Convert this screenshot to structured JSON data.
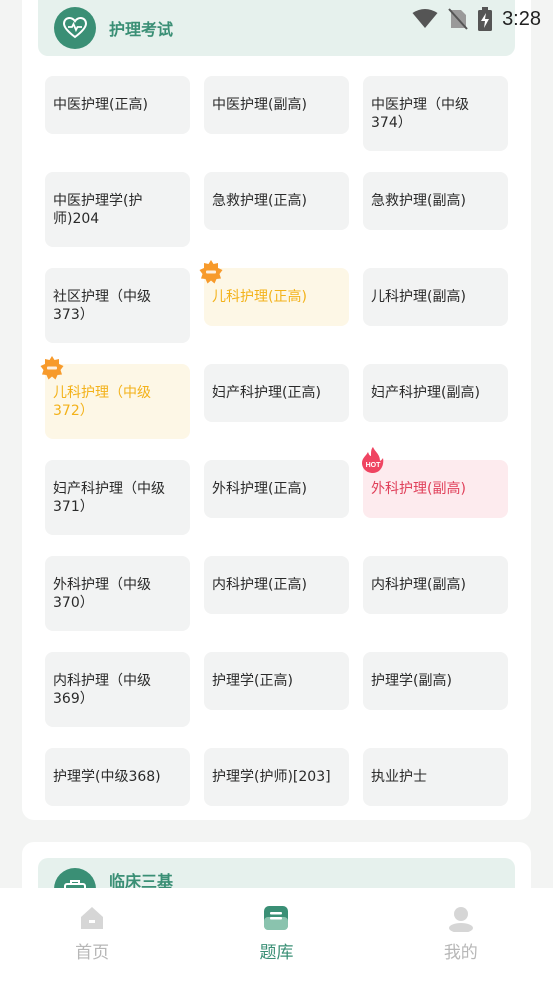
{
  "status": {
    "time": "3:28"
  },
  "section1": {
    "title": "护理考试",
    "icon": "heart-pulse-icon",
    "items": [
      {
        "lines": [
          "中医护理(正高)"
        ],
        "size": "short"
      },
      {
        "lines": [
          "中医护理(副高)"
        ],
        "size": "short"
      },
      {
        "lines": [
          "中医护理（中级",
          "374）"
        ],
        "size": "tall"
      },
      {
        "lines": [
          "中医护理学(护",
          "师)204"
        ],
        "size": "tall"
      },
      {
        "lines": [
          "急救护理(正高)"
        ],
        "size": "short"
      },
      {
        "lines": [
          "急救护理(副高)"
        ],
        "size": "short"
      },
      {
        "lines": [
          "社区护理（中级",
          "373）"
        ],
        "size": "tall"
      },
      {
        "lines": [
          "儿科护理(正高)"
        ],
        "size": "short",
        "highlight": "yellow",
        "badge": "recommend"
      },
      {
        "lines": [
          "儿科护理(副高)"
        ],
        "size": "short"
      },
      {
        "lines": [
          "儿科护理（中级",
          "372）"
        ],
        "size": "tall",
        "highlight": "yellow",
        "badge": "recommend"
      },
      {
        "lines": [
          "妇产科护理(正高)"
        ],
        "size": "short"
      },
      {
        "lines": [
          "妇产科护理(副高)"
        ],
        "size": "short"
      },
      {
        "lines": [
          "妇产科护理（中级",
          "371）"
        ],
        "size": "tall"
      },
      {
        "lines": [
          "外科护理(正高)"
        ],
        "size": "short"
      },
      {
        "lines": [
          "外科护理(副高)"
        ],
        "size": "short",
        "highlight": "red",
        "badge": "hot"
      },
      {
        "lines": [
          "外科护理（中级",
          "370）"
        ],
        "size": "tall"
      },
      {
        "lines": [
          "内科护理(正高)"
        ],
        "size": "short"
      },
      {
        "lines": [
          "内科护理(副高)"
        ],
        "size": "short"
      },
      {
        "lines": [
          "内科护理（中级",
          "369）"
        ],
        "size": "tall"
      },
      {
        "lines": [
          "护理学(正高)"
        ],
        "size": "short"
      },
      {
        "lines": [
          "护理学(副高)"
        ],
        "size": "short"
      },
      {
        "lines": [
          "护理学(中级368)"
        ],
        "size": "short"
      },
      {
        "lines": [
          "护理学(护师)[203]"
        ],
        "size": "short"
      },
      {
        "lines": [
          "执业护士"
        ],
        "size": "short"
      }
    ]
  },
  "section2": {
    "title": "临床三基",
    "icon": "medical-kit-icon"
  },
  "badges": {
    "hot": "HOT"
  },
  "nav": [
    {
      "label": "首页",
      "icon": "home-icon",
      "active": false
    },
    {
      "label": "题库",
      "icon": "question-bank-icon",
      "active": true
    },
    {
      "label": "我的",
      "icon": "profile-icon",
      "active": false
    }
  ],
  "colors": {
    "accent": "#3a8f75",
    "header_bg": "#e6f1ed",
    "highlight_yellow": "#f3b21a",
    "highlight_red": "#e0405a"
  }
}
